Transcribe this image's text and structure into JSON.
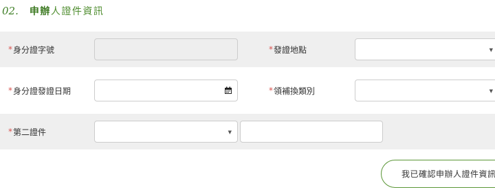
{
  "section": {
    "number": "02.",
    "title_bold": "申辦",
    "title_rest": "人證件資訊"
  },
  "required_mark": "*",
  "fields": {
    "id_number": {
      "label": "身分證字號",
      "value": ""
    },
    "issue_place": {
      "label": "發證地點",
      "selected": ""
    },
    "issue_date": {
      "label": "身分證發證日期",
      "value": ""
    },
    "reissue_type": {
      "label": "領補換類別",
      "selected": ""
    },
    "second_id": {
      "label": "第二證件",
      "selected": "",
      "number_value": ""
    }
  },
  "icons": {
    "dropdown": "caret-down",
    "calendar": "calendar-icon"
  },
  "confirm_button": {
    "label": "我已確認申辦人證件資訊"
  },
  "colors": {
    "accent_green": "#4a8a2a",
    "required_red": "#d9534f",
    "row_shade": "#efefef"
  }
}
